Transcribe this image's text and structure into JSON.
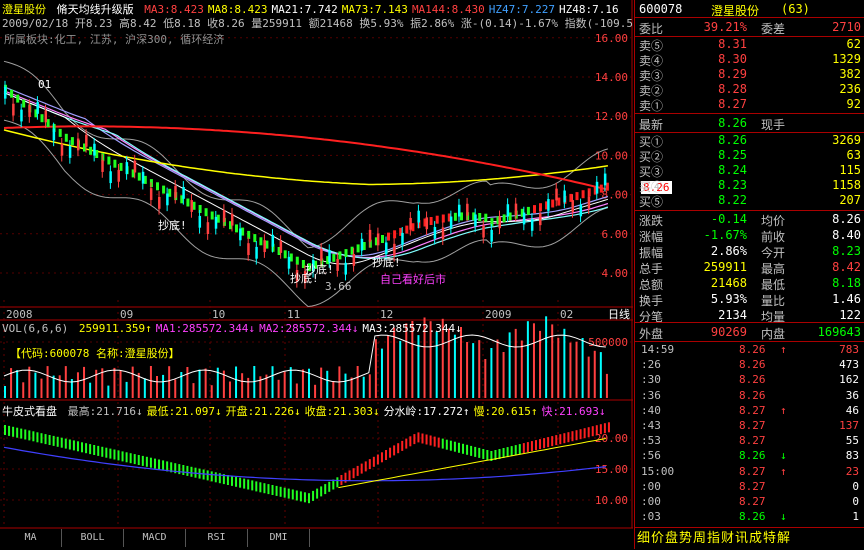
{
  "header": {
    "name": "澄星股份",
    "indicator": "脩天均线升级版",
    "ma": [
      {
        "label": "MA3:8.423",
        "color": "#ff4040"
      },
      {
        "label": "MA8:8.423",
        "color": "#ffff00"
      },
      {
        "label": "MA21:7.742",
        "color": "#ffffff"
      },
      {
        "label": "MA73:7.143",
        "color": "#ffff00"
      },
      {
        "label": "MA144:8.430",
        "color": "#ff4040"
      },
      {
        "label": "HZ47:7.227",
        "color": "#40a0ff"
      },
      {
        "label": "HZ48:7.16",
        "color": "#ffffff"
      }
    ],
    "line2": "2009/02/18 开8.23 高8.42 低8.18 收8.26 量259911 额21468 换5.93% 振2.86% 涨-(0.14)-1.67% 指数(-109.5",
    "sector": "所属板块:化工, 江苏, 沪深300, 循环经济"
  },
  "price_axis": [
    "16.00",
    "14.00",
    "12.00",
    "10.00",
    "8.00",
    "6.00",
    "4.00"
  ],
  "price_tag": "8.26",
  "annotations": [
    {
      "text": "01",
      "color": "#ffffff"
    },
    {
      "text": "抄底!",
      "color": "#ffffff"
    },
    {
      "text": "抄底!",
      "color": "#ffffff"
    },
    {
      "text": "抄底!",
      "color": "#ffffff"
    },
    {
      "text": "抄底!",
      "color": "#ffffff"
    },
    {
      "text": "3.66",
      "color": "#c0c0c0"
    },
    {
      "text": "自己看好后市",
      "color": "#ff40ff"
    }
  ],
  "date_axis": [
    "2008",
    "09",
    "10",
    "11",
    "12",
    "2009",
    "02"
  ],
  "date_axis_right": "日线",
  "vol": {
    "label": "VOL(6,6,6)",
    "vals": [
      {
        "t": "259911.359↑",
        "c": "#ffff00"
      },
      {
        "t": "MA1:285572.344↓",
        "c": "#ff40ff"
      },
      {
        "t": "MA2:285572.344↓",
        "c": "#ff40ff"
      },
      {
        "t": "MA3:285572.344↓",
        "c": "#ffffff"
      }
    ],
    "code_text": "【代码:600078 名称:澄星股份】",
    "axis": "500000"
  },
  "bull": {
    "title": "牛皮式看盘",
    "vals": [
      {
        "t": "最高:21.716↓",
        "c": "#c0c0c0"
      },
      {
        "t": "最低:21.097↓",
        "c": "#ffff00"
      },
      {
        "t": "开盘:21.226↓",
        "c": "#ffff00"
      },
      {
        "t": "收盘:21.303↓",
        "c": "#ffff00"
      },
      {
        "t": "分水岭:17.272↑",
        "c": "#ffffff"
      },
      {
        "t": "慢:20.615↑",
        "c": "#ffff00"
      },
      {
        "t": "快:21.693↓",
        "c": "#ff40ff"
      }
    ],
    "axis": [
      "20.00",
      "15.00",
      "10.00"
    ]
  },
  "tabs": [
    "MA",
    "BOLL",
    "MACD",
    "RSI",
    "DMI"
  ],
  "right": {
    "code": "600078",
    "name": "澄星股份",
    "num": "(63)",
    "weibi_label": "委比",
    "weibi_val": "39.21%",
    "weicha_label": "委差",
    "weicha_val": "2710",
    "sells": [
      {
        "l": "卖⑤",
        "p": "8.31",
        "v": "62"
      },
      {
        "l": "卖④",
        "p": "8.30",
        "v": "1329"
      },
      {
        "l": "卖③",
        "p": "8.29",
        "v": "382"
      },
      {
        "l": "卖②",
        "p": "8.28",
        "v": "236"
      },
      {
        "l": "卖①",
        "p": "8.27",
        "v": "92"
      }
    ],
    "latest_label": "最新",
    "latest_val": "8.26",
    "xianshou_label": "现手",
    "buys": [
      {
        "l": "买①",
        "p": "8.26",
        "v": "3269"
      },
      {
        "l": "买②",
        "p": "8.25",
        "v": "63"
      },
      {
        "l": "买③",
        "p": "8.24",
        "v": "115"
      },
      {
        "l": "买④",
        "p": "8.23",
        "v": "1158"
      },
      {
        "l": "买⑤",
        "p": "8.22",
        "v": "207"
      }
    ],
    "stats": [
      {
        "l1": "涨跌",
        "v1": "-0.14",
        "c1": "#00ff00",
        "l2": "均价",
        "v2": "8.26",
        "c2": "#ffffff"
      },
      {
        "l1": "涨幅",
        "v1": "-1.67%",
        "c1": "#00ff00",
        "l2": "前收",
        "v2": "8.40",
        "c2": "#ffffff"
      },
      {
        "l1": "振幅",
        "v1": "2.86%",
        "c1": "#ffffff",
        "l2": "今开",
        "v2": "8.23",
        "c2": "#00ff00"
      },
      {
        "l1": "总手",
        "v1": "259911",
        "c1": "#ffff00",
        "l2": "最高",
        "v2": "8.42",
        "c2": "#ff4040"
      },
      {
        "l1": "总额",
        "v1": "21468",
        "c1": "#ffff00",
        "l2": "最低",
        "v2": "8.18",
        "c2": "#00ff00"
      },
      {
        "l1": "换手",
        "v1": "5.93%",
        "c1": "#ffffff",
        "l2": "量比",
        "v2": "1.46",
        "c2": "#ffffff"
      },
      {
        "l1": "分笔",
        "v1": "2134",
        "c1": "#ffffff",
        "l2": "均量",
        "v2": "122",
        "c2": "#ffffff"
      }
    ],
    "waipan_label": "外盘",
    "waipan_val": "90269",
    "neipan_label": "内盘",
    "neipan_val": "169643",
    "ticks": [
      {
        "t": "14:59",
        "p": "8.26",
        "a": "↑",
        "ac": "#ff4040",
        "v": "783",
        "vc": "#ff4040"
      },
      {
        "t": ":26",
        "p": "8.26",
        "a": "",
        "ac": "#ff4040",
        "v": "473",
        "vc": "#ffffff"
      },
      {
        "t": ":30",
        "p": "8.26",
        "a": "",
        "ac": "#ff4040",
        "v": "162",
        "vc": "#ffffff"
      },
      {
        "t": ":36",
        "p": "8.26",
        "a": "",
        "ac": "#ff4040",
        "v": "36",
        "vc": "#ffffff"
      },
      {
        "t": ":40",
        "p": "8.27",
        "a": "↑",
        "ac": "#ff4040",
        "v": "46",
        "vc": "#ffffff"
      },
      {
        "t": ":43",
        "p": "8.27",
        "a": "",
        "ac": "#ff4040",
        "v": "137",
        "vc": "#ff4040"
      },
      {
        "t": ":53",
        "p": "8.27",
        "a": "",
        "ac": "#ff4040",
        "v": "55",
        "vc": "#ffffff"
      },
      {
        "t": ":56",
        "p": "8.26",
        "a": "↓",
        "ac": "#00ff00",
        "v": "83",
        "vc": "#ffffff"
      },
      {
        "t": "15:00",
        "p": "8.27",
        "a": "↑",
        "ac": "#ff4040",
        "v": "23",
        "vc": "#ff4040"
      },
      {
        "t": ":00",
        "p": "8.27",
        "a": "",
        "ac": "#ff4040",
        "v": "0",
        "vc": "#ffffff"
      },
      {
        "t": ":00",
        "p": "8.27",
        "a": "",
        "ac": "#ff4040",
        "v": "0",
        "vc": "#ffffff"
      },
      {
        "t": ":03",
        "p": "8.26",
        "a": "↓",
        "ac": "#00ff00",
        "v": "1",
        "vc": "#ffffff"
      }
    ],
    "bottom_tabs": "细价盘势周指财讯成特解"
  }
}
